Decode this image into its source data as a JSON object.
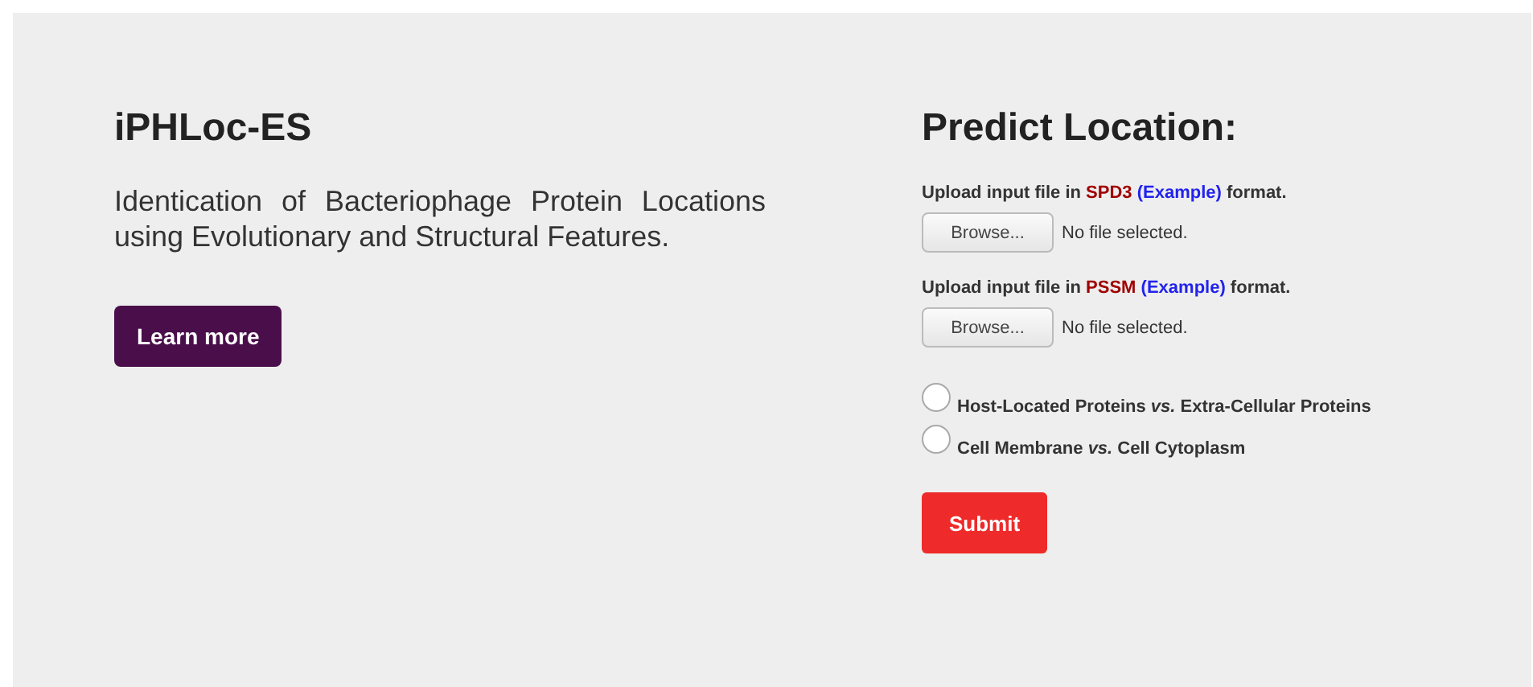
{
  "hero": {
    "title": "iPHLoc-ES",
    "description": "Identication of Bacteriophage Protein Locations using Evolutionary and Structural Features.",
    "button": "Learn more"
  },
  "predict": {
    "title": "Predict Location:",
    "uploads": [
      {
        "prefix": "Upload input file in",
        "format": "SPD3",
        "link": "(Example)",
        "suffix": "format.",
        "browse": "Browse...",
        "status": "No file selected."
      },
      {
        "prefix": "Upload input file in",
        "format": "PSSM",
        "link": "(Example)",
        "suffix": "format.",
        "browse": "Browse...",
        "status": "No file selected."
      }
    ],
    "options": [
      {
        "label": "Host-Located Proteins *vs.* Extra-Cellular Proteins",
        "selected": false
      },
      {
        "label": "Cell Membrane *vs.* Cell Cytoplasm",
        "selected": false
      }
    ],
    "submit": "Submit"
  }
}
